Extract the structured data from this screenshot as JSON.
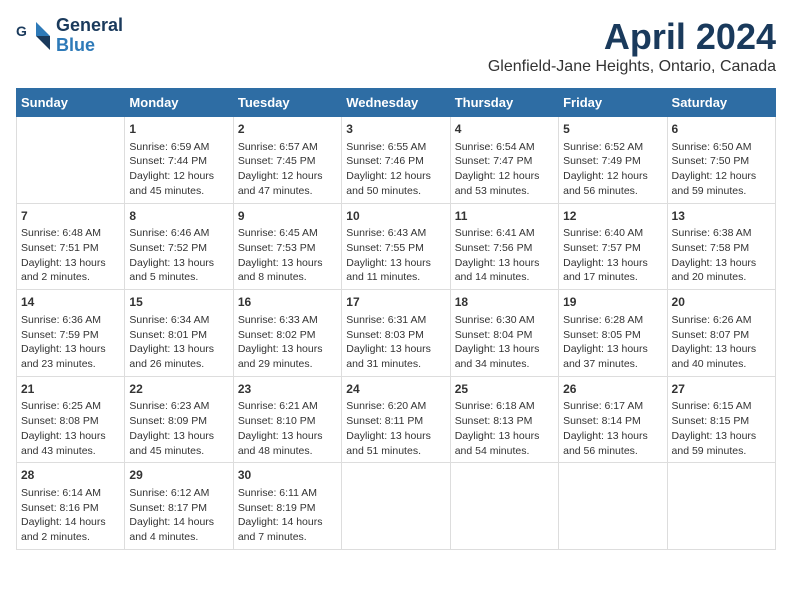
{
  "header": {
    "logo_line1": "General",
    "logo_line2": "Blue",
    "title": "April 2024",
    "subtitle": "Glenfield-Jane Heights, Ontario, Canada"
  },
  "days_of_week": [
    "Sunday",
    "Monday",
    "Tuesday",
    "Wednesday",
    "Thursday",
    "Friday",
    "Saturday"
  ],
  "weeks": [
    [
      {
        "day": "",
        "content": ""
      },
      {
        "day": "1",
        "sunrise": "Sunrise: 6:59 AM",
        "sunset": "Sunset: 7:44 PM",
        "daylight": "Daylight: 12 hours and 45 minutes."
      },
      {
        "day": "2",
        "sunrise": "Sunrise: 6:57 AM",
        "sunset": "Sunset: 7:45 PM",
        "daylight": "Daylight: 12 hours and 47 minutes."
      },
      {
        "day": "3",
        "sunrise": "Sunrise: 6:55 AM",
        "sunset": "Sunset: 7:46 PM",
        "daylight": "Daylight: 12 hours and 50 minutes."
      },
      {
        "day": "4",
        "sunrise": "Sunrise: 6:54 AM",
        "sunset": "Sunset: 7:47 PM",
        "daylight": "Daylight: 12 hours and 53 minutes."
      },
      {
        "day": "5",
        "sunrise": "Sunrise: 6:52 AM",
        "sunset": "Sunset: 7:49 PM",
        "daylight": "Daylight: 12 hours and 56 minutes."
      },
      {
        "day": "6",
        "sunrise": "Sunrise: 6:50 AM",
        "sunset": "Sunset: 7:50 PM",
        "daylight": "Daylight: 12 hours and 59 minutes."
      }
    ],
    [
      {
        "day": "7",
        "sunrise": "Sunrise: 6:48 AM",
        "sunset": "Sunset: 7:51 PM",
        "daylight": "Daylight: 13 hours and 2 minutes."
      },
      {
        "day": "8",
        "sunrise": "Sunrise: 6:46 AM",
        "sunset": "Sunset: 7:52 PM",
        "daylight": "Daylight: 13 hours and 5 minutes."
      },
      {
        "day": "9",
        "sunrise": "Sunrise: 6:45 AM",
        "sunset": "Sunset: 7:53 PM",
        "daylight": "Daylight: 13 hours and 8 minutes."
      },
      {
        "day": "10",
        "sunrise": "Sunrise: 6:43 AM",
        "sunset": "Sunset: 7:55 PM",
        "daylight": "Daylight: 13 hours and 11 minutes."
      },
      {
        "day": "11",
        "sunrise": "Sunrise: 6:41 AM",
        "sunset": "Sunset: 7:56 PM",
        "daylight": "Daylight: 13 hours and 14 minutes."
      },
      {
        "day": "12",
        "sunrise": "Sunrise: 6:40 AM",
        "sunset": "Sunset: 7:57 PM",
        "daylight": "Daylight: 13 hours and 17 minutes."
      },
      {
        "day": "13",
        "sunrise": "Sunrise: 6:38 AM",
        "sunset": "Sunset: 7:58 PM",
        "daylight": "Daylight: 13 hours and 20 minutes."
      }
    ],
    [
      {
        "day": "14",
        "sunrise": "Sunrise: 6:36 AM",
        "sunset": "Sunset: 7:59 PM",
        "daylight": "Daylight: 13 hours and 23 minutes."
      },
      {
        "day": "15",
        "sunrise": "Sunrise: 6:34 AM",
        "sunset": "Sunset: 8:01 PM",
        "daylight": "Daylight: 13 hours and 26 minutes."
      },
      {
        "day": "16",
        "sunrise": "Sunrise: 6:33 AM",
        "sunset": "Sunset: 8:02 PM",
        "daylight": "Daylight: 13 hours and 29 minutes."
      },
      {
        "day": "17",
        "sunrise": "Sunrise: 6:31 AM",
        "sunset": "Sunset: 8:03 PM",
        "daylight": "Daylight: 13 hours and 31 minutes."
      },
      {
        "day": "18",
        "sunrise": "Sunrise: 6:30 AM",
        "sunset": "Sunset: 8:04 PM",
        "daylight": "Daylight: 13 hours and 34 minutes."
      },
      {
        "day": "19",
        "sunrise": "Sunrise: 6:28 AM",
        "sunset": "Sunset: 8:05 PM",
        "daylight": "Daylight: 13 hours and 37 minutes."
      },
      {
        "day": "20",
        "sunrise": "Sunrise: 6:26 AM",
        "sunset": "Sunset: 8:07 PM",
        "daylight": "Daylight: 13 hours and 40 minutes."
      }
    ],
    [
      {
        "day": "21",
        "sunrise": "Sunrise: 6:25 AM",
        "sunset": "Sunset: 8:08 PM",
        "daylight": "Daylight: 13 hours and 43 minutes."
      },
      {
        "day": "22",
        "sunrise": "Sunrise: 6:23 AM",
        "sunset": "Sunset: 8:09 PM",
        "daylight": "Daylight: 13 hours and 45 minutes."
      },
      {
        "day": "23",
        "sunrise": "Sunrise: 6:21 AM",
        "sunset": "Sunset: 8:10 PM",
        "daylight": "Daylight: 13 hours and 48 minutes."
      },
      {
        "day": "24",
        "sunrise": "Sunrise: 6:20 AM",
        "sunset": "Sunset: 8:11 PM",
        "daylight": "Daylight: 13 hours and 51 minutes."
      },
      {
        "day": "25",
        "sunrise": "Sunrise: 6:18 AM",
        "sunset": "Sunset: 8:13 PM",
        "daylight": "Daylight: 13 hours and 54 minutes."
      },
      {
        "day": "26",
        "sunrise": "Sunrise: 6:17 AM",
        "sunset": "Sunset: 8:14 PM",
        "daylight": "Daylight: 13 hours and 56 minutes."
      },
      {
        "day": "27",
        "sunrise": "Sunrise: 6:15 AM",
        "sunset": "Sunset: 8:15 PM",
        "daylight": "Daylight: 13 hours and 59 minutes."
      }
    ],
    [
      {
        "day": "28",
        "sunrise": "Sunrise: 6:14 AM",
        "sunset": "Sunset: 8:16 PM",
        "daylight": "Daylight: 14 hours and 2 minutes."
      },
      {
        "day": "29",
        "sunrise": "Sunrise: 6:12 AM",
        "sunset": "Sunset: 8:17 PM",
        "daylight": "Daylight: 14 hours and 4 minutes."
      },
      {
        "day": "30",
        "sunrise": "Sunrise: 6:11 AM",
        "sunset": "Sunset: 8:19 PM",
        "daylight": "Daylight: 14 hours and 7 minutes."
      },
      {
        "day": "",
        "content": ""
      },
      {
        "day": "",
        "content": ""
      },
      {
        "day": "",
        "content": ""
      },
      {
        "day": "",
        "content": ""
      }
    ]
  ]
}
